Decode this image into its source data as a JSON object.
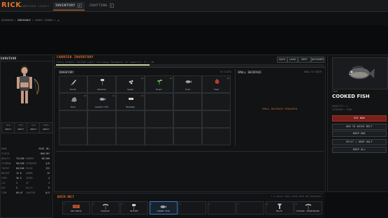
{
  "titlebar": {
    "logo": "RICK",
    "logo_sub": "SURVIVOR LEGACY",
    "tabs": [
      {
        "label": "INVENTORY",
        "key": "I",
        "active": true
      },
      {
        "label": "CRAFTING",
        "key": "C",
        "active": false
      }
    ]
  },
  "breadcrumb": {
    "part1": "DEADWOOD",
    "part2": "ENDURANCE",
    "part3": "RANGE CAMBER"
  },
  "character": {
    "header": "SURVIVOR",
    "equip": [
      {
        "slot": "HEAD",
        "value": "EMPTY"
      },
      {
        "slot": "BODY",
        "value": "EMPTY"
      },
      {
        "slot": "LEGS",
        "value": "EMPTY"
      },
      {
        "slot": "HANDS",
        "value": "EMPTY"
      }
    ],
    "stats": [
      {
        "l1": "NAME",
        "v1": "",
        "l2": "",
        "v2": "RICK (M)"
      },
      {
        "l1": "STATUS",
        "v1": "",
        "l2": "",
        "v2": "HEALTHY"
      },
      {
        "l1": "HEALTH",
        "v1": "75/100",
        "l2": "HUNGER",
        "v2": "48/100"
      },
      {
        "l1": "STAMINA",
        "v1": "90/100",
        "l2": "STRENGTH",
        "v2": "4/6"
      },
      {
        "l1": "THIRST",
        "v1": "60/100",
        "l2": "FOCUS",
        "v2": "132"
      },
      {
        "l1": "WEIGHT",
        "v1": "12.0",
        "l2": "ARMOR",
        "v2": "15"
      },
      {
        "l1": "TEMP",
        "v1": "36.5",
        "l2": "SPEED",
        "v2": "4"
      },
      {
        "l1": "LVL",
        "v1": "1",
        "l2": "XP",
        "v2": "1"
      },
      {
        "l1": "DAY",
        "v1": "3",
        "l2": "KILLS",
        "v2": "5"
      },
      {
        "l1": "TIME",
        "v1": "09:47",
        "l2": "CRAFTED",
        "v2": "0/3"
      }
    ]
  },
  "carried": {
    "header": "CARRIED INVENTORY",
    "weight_text": "Carry weight: 35/100   Light: not heavy   Backpack: ok   Capacity: 12 / 48",
    "actions": [
      "SAVE",
      "LOAD",
      "SORT",
      "AUTOSORT"
    ],
    "inventory_label": "INVENTORY",
    "slots_label": "16 SLOTS",
    "items": [
      {
        "name": "Knife",
        "qty": "",
        "icon": "knife"
      },
      {
        "name": "Hatchet",
        "qty": "",
        "icon": "axe"
      },
      {
        "name": "Seeds",
        "qty": "x4",
        "icon": "seeds"
      },
      {
        "name": "Plant",
        "qty": "x2",
        "icon": "plant"
      },
      {
        "name": "Fish",
        "qty": "",
        "icon": "fish"
      },
      {
        "name": "Food",
        "qty": "x2",
        "icon": "food"
      },
      {
        "name": "Rock",
        "qty": "x4",
        "icon": "rock"
      },
      {
        "name": "Cooked Fish",
        "qty": "x1",
        "icon": "fish"
      },
      {
        "name": "Bandage",
        "qty": "x3",
        "icon": "bandage"
      }
    ],
    "backpack_label": "SMALL BACKPACK",
    "backpack_hint": "DRAG TO EQUIP",
    "backpack_required": "SMALL BACKPACK REQUIRED"
  },
  "detail": {
    "type": "FOOD",
    "name": "COOKED FISH",
    "quantity": "QUANTITY: 1",
    "category": "CATEGORY: FOOD",
    "buttons": [
      "EAT NOW",
      "ADD TO QUICK BELT",
      "DROP ONE",
      "SPLIT / DROP HALF",
      "DROP ALL"
    ]
  },
  "quickbelt": {
    "label": "QUICK BELT",
    "hint": "1-9 SELECT   DRAG ITEMS FROM THE INVENTORY",
    "slots": [
      {
        "num": "1",
        "name": "RED BRICK",
        "icon": "brick",
        "selected": false
      },
      {
        "num": "2",
        "name": "PICKAXE",
        "icon": "pick",
        "selected": false
      },
      {
        "num": "3",
        "name": "HATCHET",
        "icon": "axe",
        "selected": false
      },
      {
        "num": "4",
        "name": "COOKED FISH",
        "icon": "fish",
        "selected": true
      },
      {
        "num": "5",
        "name": "",
        "icon": "",
        "selected": false
      },
      {
        "num": "6",
        "name": "",
        "icon": "",
        "selected": false
      },
      {
        "num": "7",
        "name": "",
        "icon": "",
        "selected": false
      },
      {
        "num": "8",
        "name": "BOLTS",
        "icon": "bolt",
        "selected": false
      },
      {
        "num": "9",
        "name": "PICKAXE (REINFORCED)",
        "icon": "pick",
        "selected": false
      }
    ]
  },
  "colors": {
    "accent": "#e5702a",
    "danger": "#7a1f1a",
    "select": "#3b7bbf"
  }
}
